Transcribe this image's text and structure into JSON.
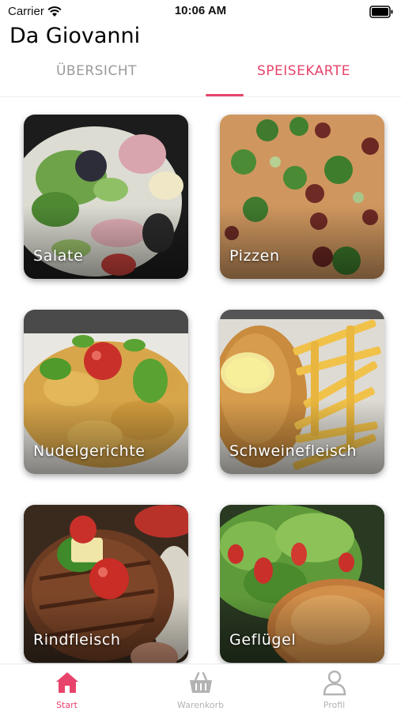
{
  "status_bar": {
    "carrier": "Carrier",
    "time": "10:06 AM"
  },
  "app": {
    "title": "Da Giovanni"
  },
  "tabs": [
    {
      "label": "ÜBERSICHT",
      "active": false
    },
    {
      "label": "SPEISEKARTE",
      "active": true
    }
  ],
  "categories": [
    {
      "label": "Salate"
    },
    {
      "label": "Pizzen"
    },
    {
      "label": "Nudelgerichte"
    },
    {
      "label": "Schweinefleisch"
    },
    {
      "label": "Rindfleisch"
    },
    {
      "label": "Geflügel"
    }
  ],
  "bottom_nav": [
    {
      "label": "Start",
      "icon": "home-icon",
      "active": true
    },
    {
      "label": "Warenkorb",
      "icon": "basket-icon",
      "active": false
    },
    {
      "label": "Profil",
      "icon": "person-icon",
      "active": false
    }
  ],
  "colors": {
    "accent": "#e8446b",
    "inactive": "#b3b3b3"
  }
}
